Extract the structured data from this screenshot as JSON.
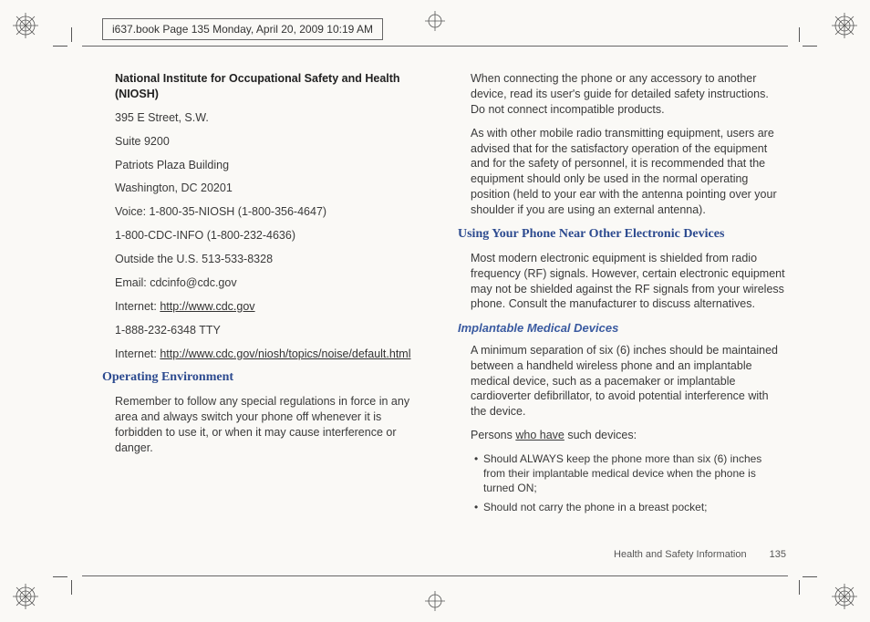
{
  "header": {
    "stamp": "i637.book  Page 135  Monday, April 20, 2009  10:19 AM"
  },
  "left": {
    "niosh_title": "National Institute for Occupational Safety and Health (NIOSH)",
    "addr1": "395 E Street, S.W.",
    "addr2": "Suite 9200",
    "addr3": "Patriots Plaza Building",
    "addr4": "Washington, DC 20201",
    "voice": "Voice: 1-800-35-NIOSH (1-800-356-4647)",
    "cdcinfo": "1-800-CDC-INFO (1-800-232-4636)",
    "outside": "Outside the U.S. 513-533-8328",
    "email": "Email: cdcinfo@cdc.gov",
    "inet_lbl": "Internet: ",
    "inet_url": "http://www.cdc.gov",
    "tty": "1-888-232-6348 TTY",
    "inet2_lbl": "Internet: ",
    "inet2_url": "http://www.cdc.gov/niosh/topics/noise/default.html",
    "op_env_h": "Operating Environment",
    "op_env_p": "Remember to follow any special regulations in force in any area and always switch your phone off whenever it is forbidden to use it, or when it may cause interference or danger."
  },
  "right": {
    "p1": "When connecting the phone or any accessory to another device, read its user's guide for detailed safety instructions. Do not connect incompatible products.",
    "p2": "As with other mobile radio transmitting equipment, users are advised that for the satisfactory operation of the equipment and for the safety of personnel, it is recommended that the equipment should only be used in the normal operating position (held to your ear with the antenna pointing over your shoulder if you are using an external antenna).",
    "h_using": "Using Your Phone Near Other Electronic Devices",
    "p3": "Most modern electronic equipment is shielded from radio frequency (RF) signals. However, certain electronic equipment may not be shielded against the RF signals from your wireless phone. Consult the manufacturer to discuss alternatives.",
    "h_implant": "Implantable Medical Devices",
    "p4": "A minimum separation of six (6) inches should be maintained between a handheld wireless phone and an implantable medical device, such as a pacemaker or implantable cardioverter defibrillator, to avoid potential interference with the device.",
    "p5_pre": "Persons ",
    "p5_u": "who have",
    "p5_post": " such devices:",
    "bul1": "Should ALWAYS keep the phone more than six (6) inches from their implantable medical device when the phone is turned ON;",
    "bul2": "Should not carry the phone in a breast pocket;"
  },
  "footer": {
    "section": "Health and Safety Information",
    "page": "135"
  }
}
